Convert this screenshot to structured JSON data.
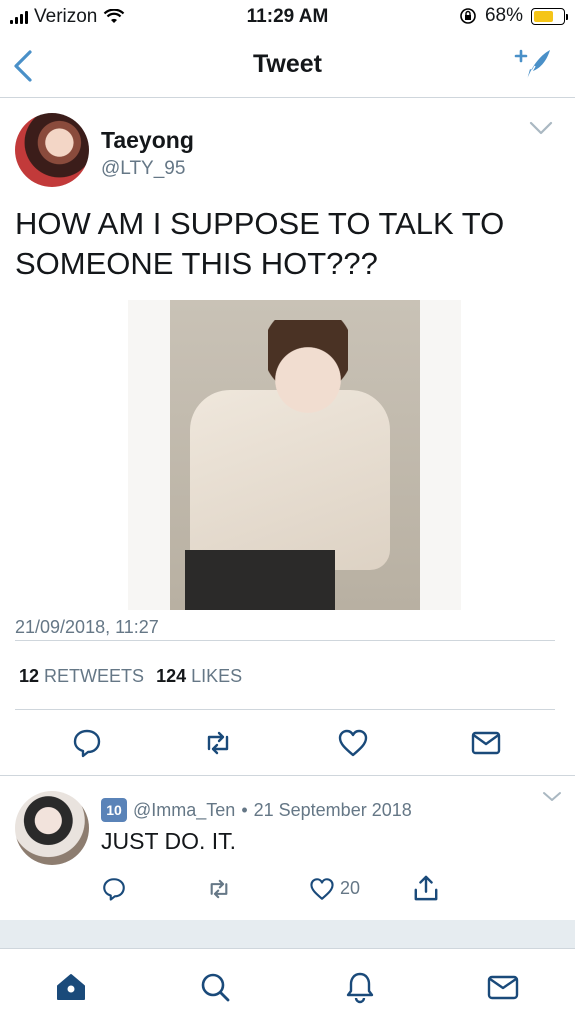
{
  "status": {
    "carrier": "Verizon",
    "time": "11:29 AM",
    "battery": "68%",
    "battery_level": 0.68
  },
  "nav": {
    "title": "Tweet"
  },
  "tweet": {
    "author_name": "Taeyong",
    "author_handle": "@LTY_95",
    "text": "HOW AM I SUPPOSE TO TALK TO SOMEONE THIS HOT???",
    "timestamp": "21/09/2018, 11:27",
    "retweets_count": "12",
    "retweets_label": "RETWEETS",
    "likes_count": "124",
    "likes_label": "LIKES"
  },
  "reply": {
    "emoji": "10",
    "handle": "@Imma_Ten",
    "separator": "•",
    "date": "21 September 2018",
    "text": "JUST DO. IT.",
    "like_count": "20"
  },
  "colors": {
    "accent": "#1da1f2",
    "icon_blue": "#4a90c8",
    "grey_text": "#657786",
    "home_active": "#1a4a7a"
  },
  "icons": [
    "back-chevron-icon",
    "compose-feather-icon",
    "chevron-down-icon",
    "reply-icon",
    "retweet-icon",
    "like-icon",
    "share-icon",
    "home-icon",
    "search-icon",
    "notifications-icon",
    "messages-icon"
  ]
}
